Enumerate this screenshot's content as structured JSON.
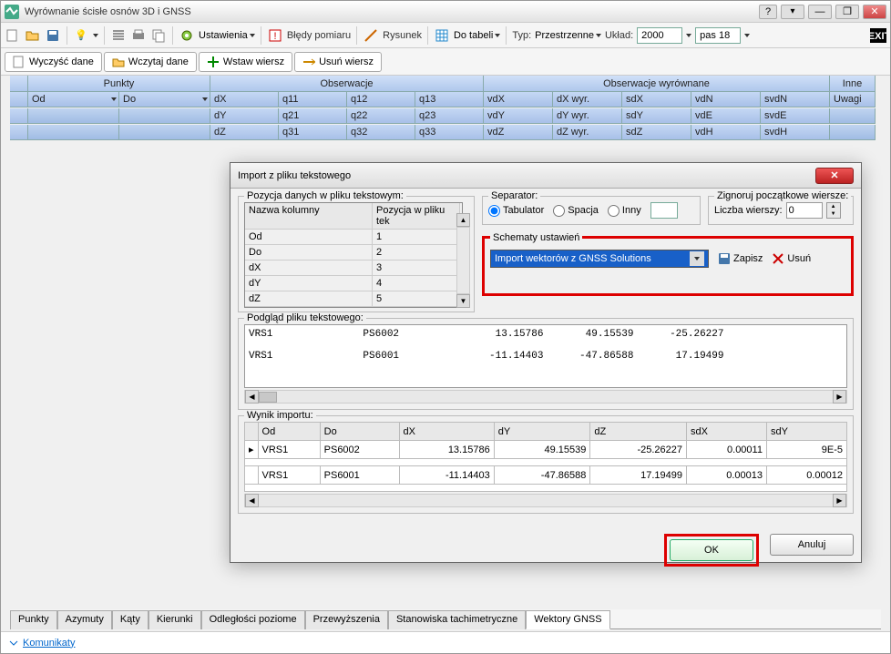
{
  "window": {
    "title": "Wyrównanie ścisłe osnów 3D i GNSS",
    "help": "?",
    "minimize": "—",
    "maximize": "❐",
    "close": "✕"
  },
  "toolbar": {
    "settings_label": "Ustawienia",
    "errors_label": "Błędy pomiaru",
    "drawing_label": "Rysunek",
    "totable_label": "Do tabeli",
    "type_label": "Typ:",
    "type_value": "Przestrzenne",
    "system_label": "Układ:",
    "system_value": "2000",
    "zone_value": "pas 18"
  },
  "buttonbar": {
    "clear": "Wyczyść dane",
    "load": "Wczytaj dane",
    "insert": "Wstaw wiersz",
    "delete": "Usuń wiersz"
  },
  "grid": {
    "groups": {
      "punkty": "Punkty",
      "obserwacje": "Obserwacje",
      "obs_wyr": "Obserwacje wyrównane",
      "inne": "Inne"
    },
    "cols": {
      "od": "Od",
      "do": "Do",
      "dX": "dX",
      "q11": "q11",
      "q12": "q12",
      "q13": "q13",
      "dY": "dY",
      "q21": "q21",
      "q22": "q22",
      "q23": "q23",
      "dZ": "dZ",
      "q31": "q31",
      "q32": "q32",
      "q33": "q33",
      "vdX": "vdX",
      "dXw": "dX wyr.",
      "sdX": "sdX",
      "vdN": "vdN",
      "svdN": "svdN",
      "vdY": "vdY",
      "dYw": "dY wyr.",
      "sdY": "sdY",
      "vdE": "vdE",
      "svdE": "svdE",
      "vdZ": "vdZ",
      "dZw": "dZ wyr.",
      "sdZ": "sdZ",
      "vdH": "vdH",
      "svdH": "svdH",
      "uwagi": "Uwagi"
    }
  },
  "tabs": [
    "Punkty",
    "Azymuty",
    "Kąty",
    "Kierunki",
    "Odległości poziome",
    "Przewyższenia",
    "Stanowiska tachimetryczne",
    "Wektory GNSS"
  ],
  "tabs_active_index": 7,
  "status": {
    "messages": "Komunikaty"
  },
  "dialog": {
    "title": "Import z pliku tekstowego",
    "pos_legend": "Pozycja danych w pliku tekstowym:",
    "col_hdr_name": "Nazwa kolumny",
    "col_hdr_pos": "Pozycja w pliku tek",
    "columns": [
      {
        "name": "Od",
        "pos": "1"
      },
      {
        "name": "Do",
        "pos": "2"
      },
      {
        "name": "dX",
        "pos": "3"
      },
      {
        "name": "dY",
        "pos": "4"
      },
      {
        "name": "dZ",
        "pos": "5"
      }
    ],
    "sep_legend": "Separator:",
    "sep_tab": "Tabulator",
    "sep_space": "Spacja",
    "sep_other": "Inny",
    "sep_other_val": "",
    "skip_legend": "Zignoruj początkowe wiersze:",
    "skip_label": "Liczba wierszy:",
    "skip_value": "0",
    "schema_legend": "Schematy ustawień",
    "schema_value": "Import wektorów z GNSS Solutions",
    "save_label": "Zapisz",
    "delete_label": "Usuń",
    "preview_legend": "Podgląd pliku tekstowego:",
    "preview_text": "VRS1               PS6002                13.15786       49.15539      -25.26227\n\nVRS1               PS6001               -11.14403      -47.86588       17.19499",
    "result_legend": "Wynik importu:",
    "result_cols": [
      "Od",
      "Do",
      "dX",
      "dY",
      "dZ",
      "sdX",
      "sdY"
    ],
    "result_rows": [
      {
        "od": "VRS1",
        "do": "PS6002",
        "dx": "13.15786",
        "dy": "49.15539",
        "dz": "-25.26227",
        "sdx": "0.00011",
        "sdy": "9E-5"
      },
      {
        "od": "VRS1",
        "do": "PS6001",
        "dx": "-11.14403",
        "dy": "-47.86588",
        "dz": "17.19499",
        "sdx": "0.00013",
        "sdy": "0.00012"
      }
    ],
    "ok": "OK",
    "cancel": "Anuluj"
  }
}
